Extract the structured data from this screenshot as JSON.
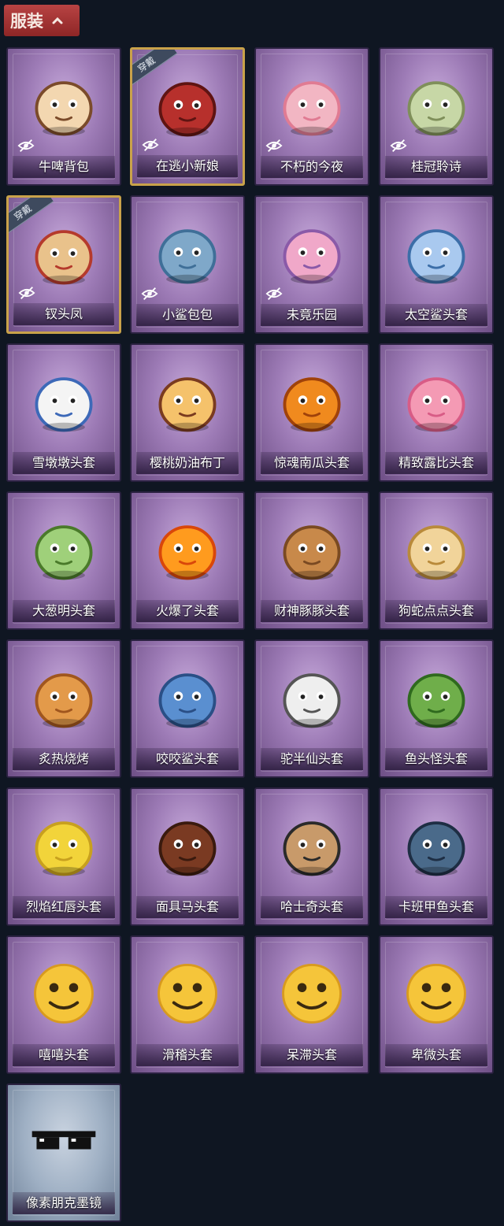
{
  "section": {
    "title": "服装",
    "expanded": true
  },
  "badge_worn": "穿戴",
  "items": [
    {
      "label": "牛啤背包",
      "hidden": true,
      "worn": false,
      "rarity": "purple",
      "icon": "cow-beer-barrel-backpack"
    },
    {
      "label": "在逃小新娘",
      "hidden": true,
      "worn": true,
      "rarity": "purple",
      "icon": "red-bride-dress"
    },
    {
      "label": "不朽的今夜",
      "hidden": true,
      "worn": false,
      "rarity": "purple",
      "icon": "pink-cat-cup"
    },
    {
      "label": "桂冠聆诗",
      "hidden": true,
      "worn": false,
      "rarity": "purple",
      "icon": "laurel-poet-charm"
    },
    {
      "label": "钗头凤",
      "hidden": true,
      "worn": true,
      "rarity": "purple",
      "icon": "phoenix-crown-doll"
    },
    {
      "label": "小鲨包包",
      "hidden": true,
      "worn": false,
      "rarity": "purple",
      "icon": "shark-plush-bag"
    },
    {
      "label": "未竟乐园",
      "hidden": true,
      "worn": false,
      "rarity": "purple",
      "icon": "unicorn-girl-doll"
    },
    {
      "label": "太空鲨头套",
      "hidden": false,
      "worn": false,
      "rarity": "purple",
      "icon": "space-shark-head"
    },
    {
      "label": "雪墩墩头套",
      "hidden": false,
      "worn": false,
      "rarity": "purple",
      "icon": "snowman-head"
    },
    {
      "label": "樱桃奶油布丁",
      "hidden": false,
      "worn": false,
      "rarity": "purple",
      "icon": "pudding-head"
    },
    {
      "label": "惊魂南瓜头套",
      "hidden": false,
      "worn": false,
      "rarity": "purple",
      "icon": "pumpkin-head"
    },
    {
      "label": "精致露比头套",
      "hidden": false,
      "worn": false,
      "rarity": "purple",
      "icon": "pink-beaver-head"
    },
    {
      "label": "大葱明头套",
      "hidden": false,
      "worn": false,
      "rarity": "purple",
      "icon": "green-onion-head"
    },
    {
      "label": "火爆了头套",
      "hidden": false,
      "worn": false,
      "rarity": "purple",
      "icon": "fire-head"
    },
    {
      "label": "财神豚豚头套",
      "hidden": false,
      "worn": false,
      "rarity": "purple",
      "icon": "capybara-head"
    },
    {
      "label": "狗蛇点点头套",
      "hidden": false,
      "worn": false,
      "rarity": "purple",
      "icon": "snake-head"
    },
    {
      "label": "炙热烧烤",
      "hidden": false,
      "worn": false,
      "rarity": "purple",
      "icon": "bbq-meat-head"
    },
    {
      "label": "咬咬鲨头套",
      "hidden": false,
      "worn": false,
      "rarity": "purple",
      "icon": "biting-shark-head"
    },
    {
      "label": "驼半仙头套",
      "hidden": false,
      "worn": false,
      "rarity": "purple",
      "icon": "alpaca-sunglasses-head"
    },
    {
      "label": "鱼头怪头套",
      "hidden": false,
      "worn": false,
      "rarity": "purple",
      "icon": "fish-head"
    },
    {
      "label": "烈焰红唇头套",
      "hidden": false,
      "worn": false,
      "rarity": "purple",
      "icon": "yellow-mouse-head"
    },
    {
      "label": "面具马头套",
      "hidden": false,
      "worn": false,
      "rarity": "purple",
      "icon": "horse-head"
    },
    {
      "label": "哈士奇头套",
      "hidden": false,
      "worn": false,
      "rarity": "purple",
      "icon": "husky-head"
    },
    {
      "label": "卡班甲鱼头套",
      "hidden": false,
      "worn": false,
      "rarity": "purple",
      "icon": "blue-fish-head"
    },
    {
      "label": "嘻嘻头套",
      "hidden": false,
      "worn": false,
      "rarity": "purple",
      "icon": "grin-emoji-head"
    },
    {
      "label": "滑稽头套",
      "hidden": false,
      "worn": false,
      "rarity": "purple",
      "icon": "smirk-emoji-head"
    },
    {
      "label": "呆滞头套",
      "hidden": false,
      "worn": false,
      "rarity": "purple",
      "icon": "stunned-emoji-head"
    },
    {
      "label": "卑微头套",
      "hidden": false,
      "worn": false,
      "rarity": "purple",
      "icon": "humble-emoji-head"
    },
    {
      "label": "像素朋克墨镜",
      "hidden": false,
      "worn": false,
      "rarity": "blue",
      "icon": "pixel-sunglasses"
    }
  ],
  "colors": {
    "background": "#0f1622",
    "header_red": "#b84343",
    "worn_border": "#c9a24a"
  }
}
